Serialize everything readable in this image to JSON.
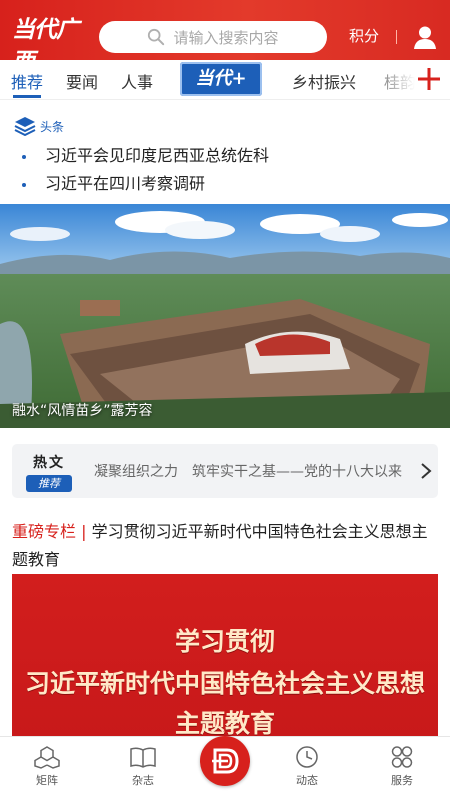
{
  "header": {
    "logo_text": "当代广西",
    "search_placeholder": "请输入搜索内容",
    "points_label": "积分"
  },
  "tabs": [
    {
      "label": "推荐",
      "active": true
    },
    {
      "label": "要闻",
      "active": false
    },
    {
      "label": "人事",
      "active": false
    },
    {
      "label": "当代+",
      "active": false
    },
    {
      "label": "乡村振兴",
      "active": false
    },
    {
      "label": "桂韵",
      "active": false
    }
  ],
  "headlines": {
    "section_label": "头条",
    "items": [
      "习近平会见印度尼西亚总统佐科",
      "习近平在四川考察调研"
    ]
  },
  "photo": {
    "caption": "融水“风情苗乡”露芳容"
  },
  "hot": {
    "title": "热文",
    "badge": "推荐",
    "text": "凝聚组织之力　筑牢实干之基——党的十八大以来"
  },
  "feature": {
    "tag": "重磅专栏",
    "title": "学习贯彻习近平新时代中国特色社会主义思想主题教育"
  },
  "banner": {
    "line1": "学习贯彻",
    "line2": "习近平新时代中国特色社会主义思想",
    "line3": "主题教育"
  },
  "bottom_nav": [
    {
      "label": "矩阵",
      "icon": "hexagon-cluster-icon"
    },
    {
      "label": "杂志",
      "icon": "open-book-icon"
    },
    {
      "label": "",
      "icon": "home-logo-icon"
    },
    {
      "label": "动态",
      "icon": "clock-icon"
    },
    {
      "label": "服务",
      "icon": "grid-circles-icon"
    }
  ],
  "colors": {
    "brand_red": "#d7211c",
    "accent_blue": "#1d5fb8"
  }
}
